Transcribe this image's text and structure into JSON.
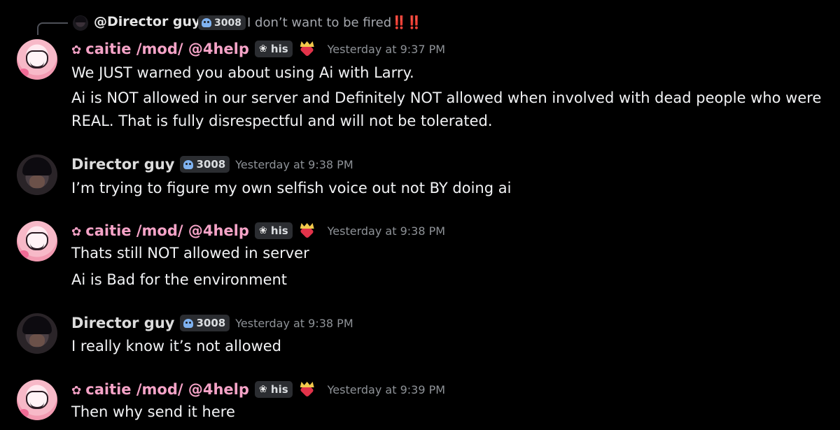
{
  "reply": {
    "author": "@Director guy",
    "tag": "3008",
    "text": "I don’t want to be fired",
    "emphasis": "‼️‼️"
  },
  "users": {
    "caitie": {
      "display_name": "caitie /mod/ @4help",
      "tag": "his",
      "name_color": "#f5a3c7"
    },
    "director": {
      "display_name": "Director guy",
      "tag": "3008",
      "name_color": "#dcdcdc"
    }
  },
  "messages": [
    {
      "author": "caitie",
      "timestamp": "Yesterday at 9:37 PM",
      "lines": [
        "We JUST warned you about using Ai with Larry.",
        "Ai is NOT allowed in our server and Definitely NOT allowed when involved with dead people who were",
        "REAL. That is fully disrespectful and will not be tolerated."
      ]
    },
    {
      "author": "director",
      "timestamp": "Yesterday at 9:38 PM",
      "lines": [
        "I’m trying to figure my own selfish voice out not BY doing ai"
      ]
    },
    {
      "author": "caitie",
      "timestamp": "Yesterday at 9:38 PM",
      "lines": [
        "Thats still NOT allowed in server",
        "Ai is Bad for the environment"
      ]
    },
    {
      "author": "director",
      "timestamp": "Yesterday at 9:38 PM",
      "lines": [
        "I really know it’s not allowed"
      ]
    },
    {
      "author": "caitie",
      "timestamp": "Yesterday at 9:39 PM",
      "lines": [
        "Then why send it here"
      ]
    }
  ],
  "colors": {
    "background": "#000000",
    "text": "#f2f3f5",
    "timestamp": "#8e9297",
    "tag_background": "#2b2d31",
    "skull_icon": "#7fb2f0",
    "reply_emphasis": "#e03131"
  }
}
